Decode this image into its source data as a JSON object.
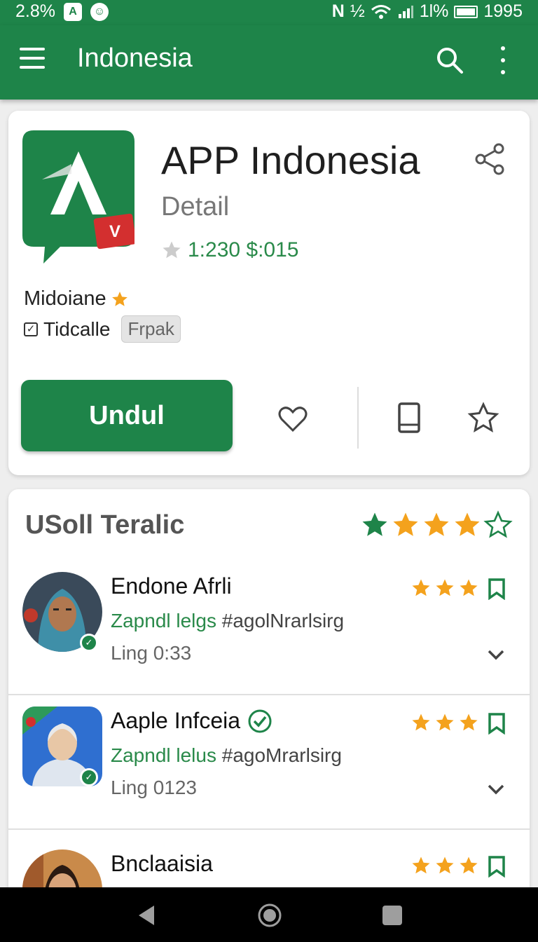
{
  "status_bar": {
    "left_text": "2.8%",
    "notif_a": "A",
    "notif_b": "☺",
    "signal_text": "½",
    "battery_text": "1l%",
    "time": "1995"
  },
  "app_bar": {
    "title": "Indonesia",
    "menu_icon": "hamburger-icon",
    "search_icon": "search-icon",
    "more_icon": "more-vert-icon"
  },
  "app_detail": {
    "name": "APP Indonesia",
    "subtitle": "Detail",
    "rating_text": "1:230 $:015",
    "developer": "Midoiane",
    "tag_label": "Tidcalle",
    "chip": "Frpak",
    "download_label": "Undul",
    "colors": {
      "primary": "#1e8449",
      "accent_red": "#d32f2f",
      "star": "#f4a21d"
    },
    "action_icons": [
      "heart-icon",
      "device-icon",
      "star-icon"
    ]
  },
  "reviews": {
    "title": "USoll Teralic",
    "overall_stars": 4,
    "items": [
      {
        "name": "Endone Afrli",
        "subtitle": "Zapndl lelgs",
        "tag": "#agolNrarlsirg",
        "time": "Ling 0:33",
        "stars": 3,
        "verified_inline": false
      },
      {
        "name": "Aaple Infceia",
        "subtitle": "Zapndl lelus",
        "tag": "#agoMrarlsirg",
        "time": "Ling 0123",
        "stars": 3,
        "verified_inline": true
      },
      {
        "name": "Bnclaaisia",
        "subtitle": "",
        "tag": "",
        "time": "",
        "stars": 3,
        "verified_inline": false
      }
    ]
  },
  "nav_bar": {
    "back_icon": "back-icon",
    "home_icon": "home-icon",
    "recents_icon": "recents-icon"
  }
}
